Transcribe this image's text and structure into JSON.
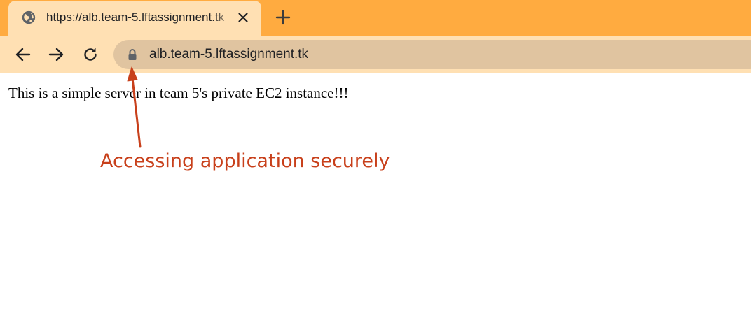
{
  "tab": {
    "title": "https://alb.team-5.lftassignment.tk",
    "favicon_icon": "globe-icon",
    "close_icon": "close-icon"
  },
  "new_tab_icon": "plus-icon",
  "toolbar": {
    "back_icon": "arrow-left-icon",
    "forward_icon": "arrow-right-icon",
    "reload_icon": "reload-icon",
    "lock_icon": "lock-icon",
    "url": "alb.team-5.lftassignment.tk"
  },
  "page": {
    "body_text": "This is a simple server in team 5's private EC2 instance!!!"
  },
  "annotation": {
    "text": "Accessing application securely",
    "color": "#c8401b"
  },
  "colors": {
    "tab_strip": "#ffab40",
    "active_tab": "#ffe0b3",
    "omnibox": "#e0c4a0"
  }
}
